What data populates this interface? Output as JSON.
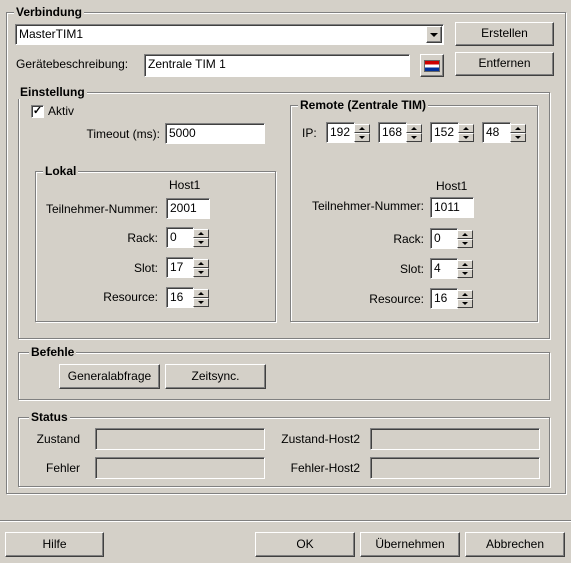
{
  "verbindung": {
    "legend": "Verbindung",
    "connection_value": "MasterTIM1",
    "description_label": "Gerätebeschreibung:",
    "description_value": "Zentrale TIM 1",
    "create_button": "Erstellen",
    "remove_button": "Entfernen"
  },
  "einstellung": {
    "legend": "Einstellung",
    "aktiv_label": "Aktiv",
    "aktiv_checked": "✓",
    "timeout_label": "Timeout (ms):",
    "timeout_value": "5000",
    "lokal": {
      "legend": "Lokal",
      "host_header": "Host1",
      "teilnehmer_label": "Teilnehmer-Nummer:",
      "teilnehmer_value": "2001",
      "rack_label": "Rack:",
      "rack_value": "0",
      "slot_label": "Slot:",
      "slot_value": "17",
      "resource_label": "Resource:",
      "resource_value": "16"
    },
    "remote": {
      "legend": "Remote (Zentrale TIM)",
      "ip_label": "IP:",
      "ip": [
        "192",
        "168",
        "152",
        "48"
      ],
      "host_header": "Host1",
      "teilnehmer_label": "Teilnehmer-Nummer:",
      "teilnehmer_value": "1011",
      "rack_label": "Rack:",
      "rack_value": "0",
      "slot_label": "Slot:",
      "slot_value": "4",
      "resource_label": "Resource:",
      "resource_value": "16"
    }
  },
  "befehle": {
    "legend": "Befehle",
    "generalabfrage_button": "Generalabfrage",
    "zeitsync_button": "Zeitsync."
  },
  "status": {
    "legend": "Status",
    "zustand_label": "Zustand",
    "zustand_value": "",
    "fehler_label": "Fehler",
    "fehler_value": "",
    "zustand_host2_label": "Zustand-Host2",
    "zustand_host2_value": "",
    "fehler_host2_label": "Fehler-Host2",
    "fehler_host2_value": ""
  },
  "footer": {
    "help_button": "Hilfe",
    "ok_button": "OK",
    "apply_button": "Übernehmen",
    "cancel_button": "Abbrechen"
  }
}
